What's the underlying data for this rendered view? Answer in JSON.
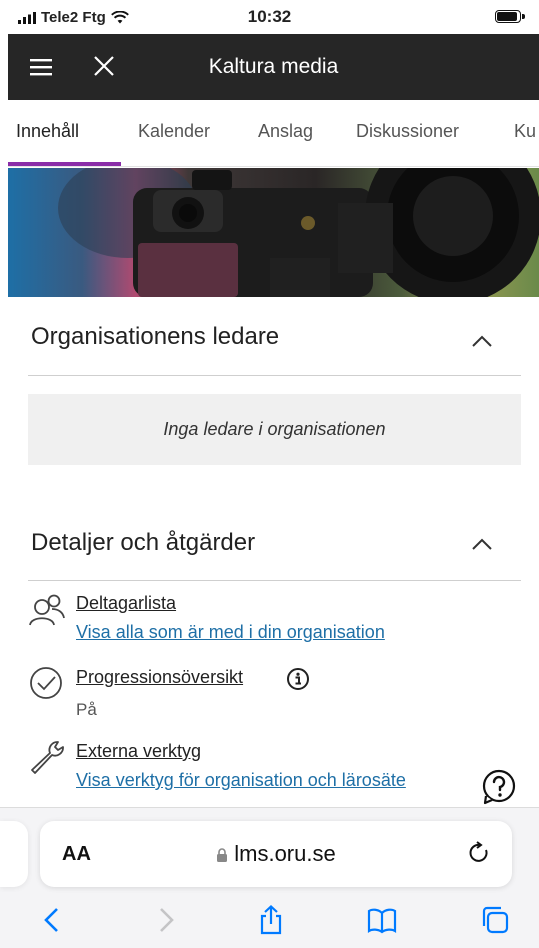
{
  "status_bar": {
    "carrier": "Tele2 Ftg",
    "time": "10:32"
  },
  "app_bar": {
    "title": "Kaltura media"
  },
  "tabs": [
    {
      "label": "Innehåll",
      "active": true
    },
    {
      "label": "Kalender"
    },
    {
      "label": "Anslag"
    },
    {
      "label": "Diskussioner"
    },
    {
      "label": "Ku"
    }
  ],
  "leaders_section": {
    "title": "Organisationens ledare",
    "empty_text": "Inga ledare i organisationen"
  },
  "details_section": {
    "title": "Detaljer och åtgärder",
    "items": [
      {
        "title": "Deltagarlista",
        "link": "Visa alla som är med i din organisation",
        "icon": "people-icon"
      },
      {
        "title": "Progressionsöversikt",
        "subtitle": "På",
        "icon": "check-circle-icon"
      },
      {
        "title": "Externa verktyg",
        "link": "Visa verktyg för organisation och lärosäte",
        "icon": "wrench-icon"
      }
    ]
  },
  "browser": {
    "text_size_label": "AA",
    "url": "lms.oru.se"
  },
  "colors": {
    "accent": "#8a2da8",
    "link": "#1e6fa6",
    "app_bar": "#262626",
    "ios_blue": "#007aff"
  }
}
